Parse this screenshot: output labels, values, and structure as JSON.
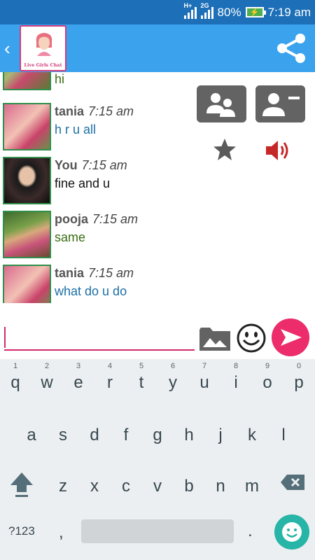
{
  "status_bar": {
    "network_label_1": "H+",
    "network_label_2": "2G",
    "battery": "80%",
    "time": "7:19 am"
  },
  "app_bar": {
    "logo_caption": "Live Girls Chat"
  },
  "messages": [
    {
      "sender": "",
      "time": "",
      "text": "hi",
      "text_color": "green"
    },
    {
      "sender": "tania",
      "time": "7:15 am",
      "text": "h r u all",
      "text_color": "blue"
    },
    {
      "sender": "You",
      "time": "7:15 am",
      "text": "fine and u",
      "text_color": "black"
    },
    {
      "sender": "pooja",
      "time": "7:15 am",
      "text": "same",
      "text_color": "green"
    },
    {
      "sender": "tania",
      "time": "7:15 am",
      "text": "what do u do",
      "text_color": "blue"
    }
  ],
  "composer": {
    "value": "",
    "placeholder": ""
  },
  "keyboard": {
    "row1": [
      {
        "k": "q",
        "h": "1"
      },
      {
        "k": "w",
        "h": "2"
      },
      {
        "k": "e",
        "h": "3"
      },
      {
        "k": "r",
        "h": "4"
      },
      {
        "k": "t",
        "h": "5"
      },
      {
        "k": "y",
        "h": "6"
      },
      {
        "k": "u",
        "h": "7"
      },
      {
        "k": "i",
        "h": "8"
      },
      {
        "k": "o",
        "h": "9"
      },
      {
        "k": "p",
        "h": "0"
      }
    ],
    "row2": [
      "a",
      "s",
      "d",
      "f",
      "g",
      "h",
      "j",
      "k",
      "l"
    ],
    "row3": [
      "z",
      "x",
      "c",
      "v",
      "b",
      "n",
      "m"
    ],
    "symbols_label": "?123",
    "comma": ",",
    "period": "."
  },
  "colors": {
    "status_bar": "#1d6fb8",
    "app_bar": "#3ba3ee",
    "accent": "#ec2c6b",
    "speaker": "#c62828"
  }
}
